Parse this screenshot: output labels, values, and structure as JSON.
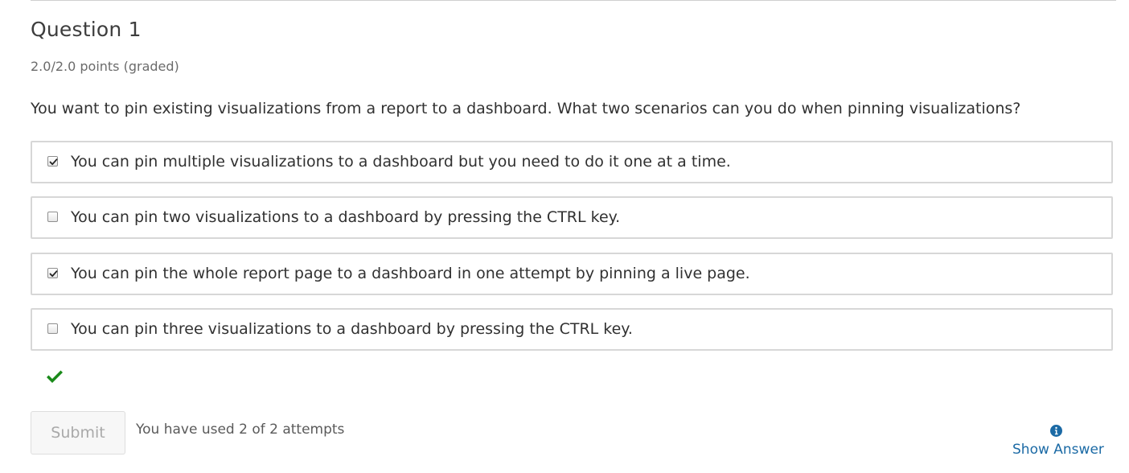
{
  "question": {
    "title": "Question 1",
    "points": "2.0/2.0 points (graded)",
    "prompt": "You want to pin existing visualizations from a report to a dashboard. What two scenarios can you do when pinning visualizations?"
  },
  "choices": [
    {
      "label": "You can pin multiple visualizations to a dashboard but you need to do it one at a time.",
      "checked": true
    },
    {
      "label": "You can pin two visualizations to a dashboard by pressing the CTRL key.",
      "checked": false
    },
    {
      "label": "You can pin the whole report page to a dashboard in one attempt by pinning a live page.",
      "checked": true
    },
    {
      "label": "You can pin three visualizations to a dashboard by pressing the CTRL key.",
      "checked": false
    }
  ],
  "result": {
    "icon": "checkmark-icon",
    "color": "#1a8a1a"
  },
  "actions": {
    "submit_label": "Submit",
    "attempts_text": "You have used 2 of 2 attempts",
    "show_answer_label": "Show Answer",
    "show_answer_icon": "info-icon",
    "link_color": "#1b6aa5"
  }
}
